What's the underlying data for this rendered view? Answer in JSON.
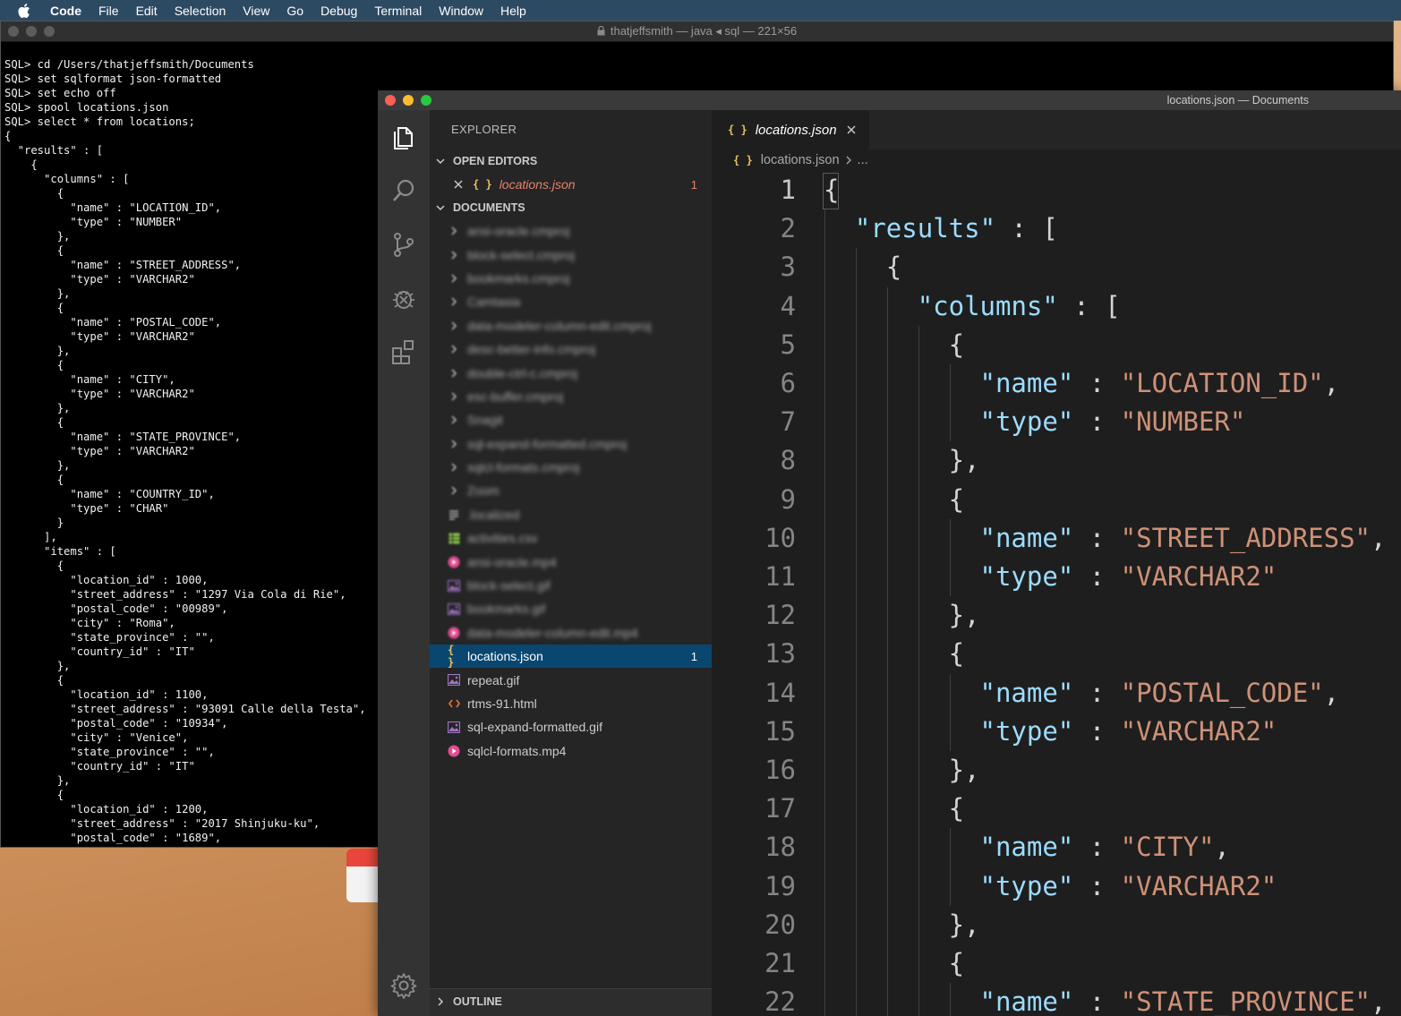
{
  "menubar": {
    "items": [
      "Code",
      "File",
      "Edit",
      "Selection",
      "View",
      "Go",
      "Debug",
      "Terminal",
      "Window",
      "Help"
    ]
  },
  "terminal": {
    "title": "thatjeffsmith — java ◂ sql — 221×56",
    "lines": [
      "SQL> cd /Users/thatjeffsmith/Documents",
      "SQL> set sqlformat json-formatted",
      "SQL> set echo off",
      "SQL> spool locations.json",
      "SQL> select * from locations;",
      "{",
      "  \"results\" : [",
      "    {",
      "      \"columns\" : [",
      "        {",
      "          \"name\" : \"LOCATION_ID\",",
      "          \"type\" : \"NUMBER\"",
      "        },",
      "        {",
      "          \"name\" : \"STREET_ADDRESS\",",
      "          \"type\" : \"VARCHAR2\"",
      "        },",
      "        {",
      "          \"name\" : \"POSTAL_CODE\",",
      "          \"type\" : \"VARCHAR2\"",
      "        },",
      "        {",
      "          \"name\" : \"CITY\",",
      "          \"type\" : \"VARCHAR2\"",
      "        },",
      "        {",
      "          \"name\" : \"STATE_PROVINCE\",",
      "          \"type\" : \"VARCHAR2\"",
      "        },",
      "        {",
      "          \"name\" : \"COUNTRY_ID\",",
      "          \"type\" : \"CHAR\"",
      "        }",
      "      ],",
      "      \"items\" : [",
      "        {",
      "          \"location_id\" : 1000,",
      "          \"street_address\" : \"1297 Via Cola di Rie\",",
      "          \"postal_code\" : \"00989\",",
      "          \"city\" : \"Roma\",",
      "          \"state_province\" : \"\",",
      "          \"country_id\" : \"IT\"",
      "        },",
      "        {",
      "          \"location_id\" : 1100,",
      "          \"street_address\" : \"93091 Calle della Testa\",",
      "          \"postal_code\" : \"10934\",",
      "          \"city\" : \"Venice\",",
      "          \"state_province\" : \"\",",
      "          \"country_id\" : \"IT\"",
      "        },",
      "        {",
      "          \"location_id\" : 1200,",
      "          \"street_address\" : \"2017 Shinjuku-ku\",",
      "          \"postal_code\" : \"1689\","
    ]
  },
  "vscode": {
    "window_title": "locations.json — Documents",
    "explorer_title": "EXPLORER",
    "open_editors_label": "OPEN EDITORS",
    "open_editor_file": "locations.json",
    "open_editor_badge": "1",
    "folder_label": "DOCUMENTS",
    "outline_label": "OUTLINE",
    "files": [
      {
        "name": "ansi-oracle.cmproj",
        "kind": "folder",
        "blurred": true
      },
      {
        "name": "block-select.cmproj",
        "kind": "folder",
        "blurred": true
      },
      {
        "name": "bookmarks.cmproj",
        "kind": "folder",
        "blurred": true
      },
      {
        "name": "Camtasia",
        "kind": "folder",
        "blurred": true
      },
      {
        "name": "data-modeler-column-edit.cmproj",
        "kind": "folder",
        "blurred": true
      },
      {
        "name": "desc-better-info.cmproj",
        "kind": "folder",
        "blurred": true
      },
      {
        "name": "double-ctrl-c.cmproj",
        "kind": "folder",
        "blurred": true
      },
      {
        "name": "esc-buffer.cmproj",
        "kind": "folder",
        "blurred": true
      },
      {
        "name": "Snagit",
        "kind": "folder",
        "blurred": true
      },
      {
        "name": "sql-expand-formatted.cmproj",
        "kind": "folder",
        "blurred": true
      },
      {
        "name": "sqlcl-formats.cmproj",
        "kind": "folder",
        "blurred": true
      },
      {
        "name": "Zoom",
        "kind": "folder",
        "blurred": true
      },
      {
        "name": ".localized",
        "kind": "text",
        "blurred": true
      },
      {
        "name": "activities.csv",
        "kind": "csv",
        "blurred": true
      },
      {
        "name": "ansi-oracle.mp4",
        "kind": "video",
        "blurred": true
      },
      {
        "name": "block-select.gif",
        "kind": "image",
        "blurred": true
      },
      {
        "name": "bookmarks.gif",
        "kind": "image",
        "blurred": true
      },
      {
        "name": "data-modeler-column-edit.mp4",
        "kind": "video",
        "blurred": true
      },
      {
        "name": "locations.json",
        "kind": "json",
        "blurred": false,
        "selected": true,
        "badge": "1"
      },
      {
        "name": "repeat.gif",
        "kind": "image",
        "blurred": false
      },
      {
        "name": "rtms-91.html",
        "kind": "html",
        "blurred": false
      },
      {
        "name": "sql-expand-formatted.gif",
        "kind": "image",
        "blurred": false
      },
      {
        "name": "sqlcl-formats.mp4",
        "kind": "video",
        "blurred": false
      }
    ],
    "tab_label": "locations.json",
    "breadcrumb_file": "locations.json",
    "breadcrumb_more": "...",
    "code_lines": [
      {
        "n": "1",
        "indent": 0,
        "parts": [
          [
            "p",
            "{"
          ]
        ]
      },
      {
        "n": "2",
        "indent": 1,
        "parts": [
          [
            "k",
            "\"results\""
          ],
          [
            "p",
            " : ["
          ]
        ]
      },
      {
        "n": "3",
        "indent": 2,
        "parts": [
          [
            "p",
            "{"
          ]
        ]
      },
      {
        "n": "4",
        "indent": 3,
        "parts": [
          [
            "k",
            "\"columns\""
          ],
          [
            "p",
            " : ["
          ]
        ]
      },
      {
        "n": "5",
        "indent": 4,
        "parts": [
          [
            "p",
            "{"
          ]
        ]
      },
      {
        "n": "6",
        "indent": 5,
        "parts": [
          [
            "k",
            "\"name\""
          ],
          [
            "p",
            " : "
          ],
          [
            "s",
            "\"LOCATION_ID\""
          ],
          [
            "p",
            ","
          ]
        ]
      },
      {
        "n": "7",
        "indent": 5,
        "parts": [
          [
            "k",
            "\"type\""
          ],
          [
            "p",
            " : "
          ],
          [
            "s",
            "\"NUMBER\""
          ]
        ]
      },
      {
        "n": "8",
        "indent": 4,
        "parts": [
          [
            "p",
            "},"
          ]
        ]
      },
      {
        "n": "9",
        "indent": 4,
        "parts": [
          [
            "p",
            "{"
          ]
        ]
      },
      {
        "n": "10",
        "indent": 5,
        "parts": [
          [
            "k",
            "\"name\""
          ],
          [
            "p",
            " : "
          ],
          [
            "s",
            "\"STREET_ADDRESS\""
          ],
          [
            "p",
            ","
          ]
        ]
      },
      {
        "n": "11",
        "indent": 5,
        "parts": [
          [
            "k",
            "\"type\""
          ],
          [
            "p",
            " : "
          ],
          [
            "s",
            "\"VARCHAR2\""
          ]
        ]
      },
      {
        "n": "12",
        "indent": 4,
        "parts": [
          [
            "p",
            "},"
          ]
        ]
      },
      {
        "n": "13",
        "indent": 4,
        "parts": [
          [
            "p",
            "{"
          ]
        ]
      },
      {
        "n": "14",
        "indent": 5,
        "parts": [
          [
            "k",
            "\"name\""
          ],
          [
            "p",
            " : "
          ],
          [
            "s",
            "\"POSTAL_CODE\""
          ],
          [
            "p",
            ","
          ]
        ]
      },
      {
        "n": "15",
        "indent": 5,
        "parts": [
          [
            "k",
            "\"type\""
          ],
          [
            "p",
            " : "
          ],
          [
            "s",
            "\"VARCHAR2\""
          ]
        ]
      },
      {
        "n": "16",
        "indent": 4,
        "parts": [
          [
            "p",
            "},"
          ]
        ]
      },
      {
        "n": "17",
        "indent": 4,
        "parts": [
          [
            "p",
            "{"
          ]
        ]
      },
      {
        "n": "18",
        "indent": 5,
        "parts": [
          [
            "k",
            "\"name\""
          ],
          [
            "p",
            " : "
          ],
          [
            "s",
            "\"CITY\""
          ],
          [
            "p",
            ","
          ]
        ]
      },
      {
        "n": "19",
        "indent": 5,
        "parts": [
          [
            "k",
            "\"type\""
          ],
          [
            "p",
            " : "
          ],
          [
            "s",
            "\"VARCHAR2\""
          ]
        ]
      },
      {
        "n": "20",
        "indent": 4,
        "parts": [
          [
            "p",
            "},"
          ]
        ]
      },
      {
        "n": "21",
        "indent": 4,
        "parts": [
          [
            "p",
            "{"
          ]
        ]
      },
      {
        "n": "22",
        "indent": 5,
        "parts": [
          [
            "k",
            "\"name\""
          ],
          [
            "p",
            " : "
          ],
          [
            "s",
            "\"STATE_PROVINCE\""
          ],
          [
            "p",
            ","
          ]
        ]
      }
    ],
    "colors": {
      "key": "#9cdcfe",
      "string": "#ce9178",
      "selection": "#094771",
      "badge": "#e8806a",
      "json_icon": "#e8c264"
    }
  }
}
